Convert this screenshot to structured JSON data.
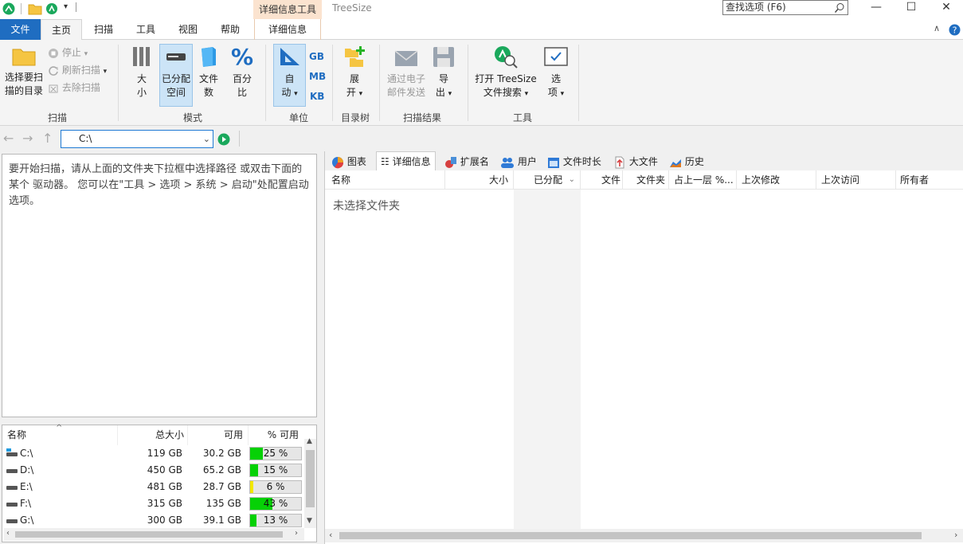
{
  "titlebar": {
    "context_tab_header": "详细信息工具",
    "app_title": "TreeSize",
    "search_placeholder": "查找选项 (F6)"
  },
  "ribbon_tabs": [
    "文件",
    "主页",
    "扫描",
    "工具",
    "视图",
    "帮助",
    "详细信息"
  ],
  "ribbon": {
    "scan_group": {
      "choose_label_1": "选择要扫",
      "choose_label_2": "描的目录",
      "stop": "停止",
      "refresh": "刷新扫描",
      "remove": "去除扫描",
      "label": "扫描"
    },
    "mode_group": {
      "size_1": "大",
      "size_2": "小",
      "alloc_1": "已分配",
      "alloc_2": "空间",
      "files_1": "文件",
      "files_2": "数",
      "percent_1": "百分",
      "percent_2": "比",
      "label": "模式"
    },
    "unit_group": {
      "auto_1": "自",
      "auto_2": "动",
      "gb": "GB",
      "mb": "MB",
      "kb": "KB",
      "label": "单位"
    },
    "tree_group": {
      "expand_1": "展",
      "expand_2": "开",
      "label": "目录树"
    },
    "results_group": {
      "email_1": "通过电子",
      "email_2": "邮件发送",
      "export_1": "导",
      "export_2": "出",
      "label": "扫描结果"
    },
    "tools_group": {
      "open_search_1": "打开 TreeSize",
      "open_search_2": "文件搜索",
      "options_1": "选",
      "options_2": "项",
      "label": "工具"
    }
  },
  "address": {
    "path": "C:\\"
  },
  "left_hint": "要开始扫描，请从上面的文件夹下拉框中选择路径 或双击下面的某个 驱动器。 您可以在\"工具 > 选项 > 系统 > 启动\"处配置启动选项。",
  "drives": {
    "headers": {
      "name": "名称",
      "total": "总大小",
      "free": "可用",
      "pct": "% 可用"
    },
    "rows": [
      {
        "name": "C:\\",
        "total": "119 GB",
        "free": "30.2 GB",
        "pct": "25 %",
        "pct_value": 25,
        "color": "#06d106"
      },
      {
        "name": "D:\\",
        "total": "450 GB",
        "free": "65.2 GB",
        "pct": "15 %",
        "pct_value": 15,
        "color": "#06d106"
      },
      {
        "name": "E:\\",
        "total": "481 GB",
        "free": "28.7 GB",
        "pct": "6 %",
        "pct_value": 6,
        "color": "#f2e800"
      },
      {
        "name": "F:\\",
        "total": "315 GB",
        "free": "135 GB",
        "pct": "43 %",
        "pct_value": 43,
        "color": "#06d106"
      },
      {
        "name": "G:\\",
        "total": "300 GB",
        "free": "39.1 GB",
        "pct": "13 %",
        "pct_value": 13,
        "color": "#06d106"
      }
    ]
  },
  "view_tabs": [
    "图表",
    "详细信息",
    "扩展名",
    "用户",
    "文件时长",
    "大文件",
    "历史"
  ],
  "detail_columns": [
    "名称",
    "大小",
    "已分配",
    "文件",
    "文件夹",
    "占上一层 %...",
    "上次修改",
    "上次访问",
    "所有者"
  ],
  "empty_message": "未选择文件夹",
  "colors": {
    "accent": "#1f6dc1",
    "context_tab": "#fbe3cf",
    "bar_green": "#06d106",
    "bar_yellow": "#f2e800"
  }
}
